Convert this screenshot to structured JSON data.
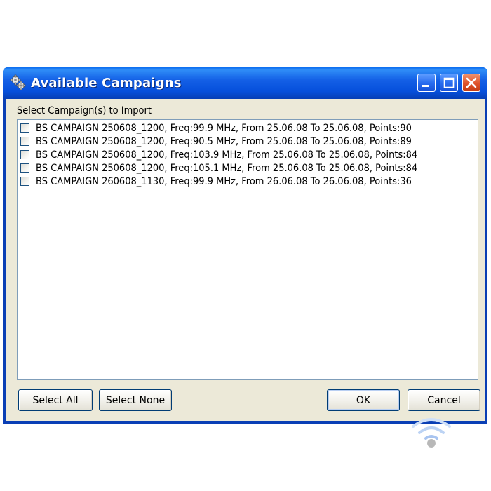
{
  "window": {
    "title": "Available Campaigns",
    "icon": "gears-icon",
    "controls": [
      "minimize-icon",
      "maximize-icon",
      "close-icon"
    ]
  },
  "list": {
    "label": "Select Campaign(s) to Import",
    "items": [
      {
        "label": "BS CAMPAIGN 250608_1200, Freq:99.9 MHz, From 25.06.08 To 25.06.08, Points:90",
        "checked": false
      },
      {
        "label": "BS CAMPAIGN 250608_1200, Freq:90.5 MHz, From 25.06.08 To 25.06.08, Points:89",
        "checked": false
      },
      {
        "label": "BS CAMPAIGN 250608_1200, Freq:103.9 MHz, From 25.06.08 To 25.06.08, Points:84",
        "checked": false
      },
      {
        "label": "BS CAMPAIGN 250608_1200, Freq:105.1 MHz, From 25.06.08 To 25.06.08, Points:84",
        "checked": false
      },
      {
        "label": "BS CAMPAIGN 260608_1130, Freq:99.9 MHz, From 26.06.08 To 26.06.08, Points:36",
        "checked": false
      }
    ]
  },
  "buttons": {
    "select_all": "Select All",
    "select_none": "Select None",
    "ok": "OK",
    "cancel": "Cancel"
  },
  "colors": {
    "titlebar": "#0a50dc",
    "face": "#ece9d8",
    "list_border": "#7f9db9",
    "close_button": "#e0532a",
    "watermark": "#a8c4f0"
  },
  "overlay": {
    "icon": "wifi-icon"
  }
}
